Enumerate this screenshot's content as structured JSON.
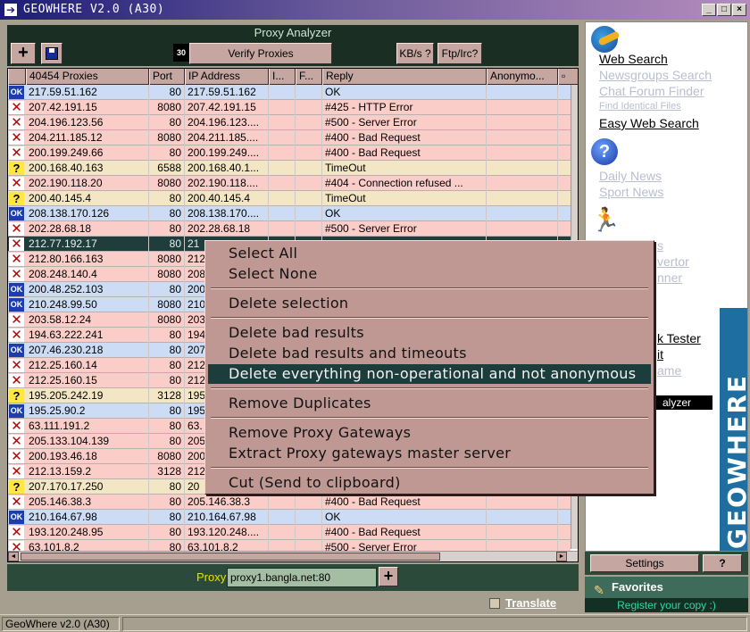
{
  "window": {
    "title": "GEOWHERE V2.0 (A30)",
    "buttons": {
      "minimize": "_",
      "maximize": "□",
      "close": "×"
    }
  },
  "analyzer": {
    "title": "Proxy Analyzer",
    "toolbar": {
      "add_label": "+",
      "save_icon": "floppy-disk-icon",
      "count": "30",
      "verify_label": "Verify Proxies",
      "kbs_label": "KB/s ?",
      "ftpirc_label": "Ftp/Irc?"
    },
    "columns": [
      "40454 Proxies",
      "Port",
      "IP Address",
      "I...",
      "F...",
      "Reply",
      "Anonymo..."
    ],
    "rows": [
      {
        "status": "ok",
        "icon": "OK",
        "proxy": "217.59.51.162",
        "port": "80",
        "ip": "217.59.51.162",
        "reply": "OK"
      },
      {
        "status": "bad",
        "icon": "✕",
        "proxy": "207.42.191.15",
        "port": "8080",
        "ip": "207.42.191.15",
        "reply": "#425 - HTTP Error"
      },
      {
        "status": "bad",
        "icon": "✕",
        "proxy": "204.196.123.56",
        "port": "80",
        "ip": "204.196.123....",
        "reply": "#500 - Server Error"
      },
      {
        "status": "bad",
        "icon": "✕",
        "proxy": "204.211.185.12",
        "port": "8080",
        "ip": "204.211.185....",
        "reply": "#400 - Bad Request"
      },
      {
        "status": "bad",
        "icon": "✕",
        "proxy": "200.199.249.66",
        "port": "80",
        "ip": "200.199.249....",
        "reply": "#400 - Bad Request"
      },
      {
        "status": "wait",
        "icon": "?",
        "proxy": "200.168.40.163",
        "port": "6588",
        "ip": "200.168.40.1...",
        "reply": "TimeOut"
      },
      {
        "status": "bad",
        "icon": "✕",
        "proxy": "202.190.118.20",
        "port": "8080",
        "ip": "202.190.118....",
        "reply": "#404 - Connection refused ..."
      },
      {
        "status": "wait",
        "icon": "?",
        "proxy": "200.40.145.4",
        "port": "80",
        "ip": "200.40.145.4",
        "reply": "TimeOut"
      },
      {
        "status": "ok",
        "icon": "OK",
        "proxy": "208.138.170.126",
        "port": "80",
        "ip": "208.138.170....",
        "reply": "OK"
      },
      {
        "status": "bad",
        "icon": "✕",
        "proxy": "202.28.68.18",
        "port": "80",
        "ip": "202.28.68.18",
        "reply": "#500 - Server Error"
      },
      {
        "status": "sel",
        "icon": "✕",
        "proxy": "212.77.192.17",
        "port": "80",
        "ip": "21",
        "reply": ""
      },
      {
        "status": "bad",
        "icon": "✕",
        "proxy": "212.80.166.163",
        "port": "8080",
        "ip": "212",
        "reply": ""
      },
      {
        "status": "bad",
        "icon": "✕",
        "proxy": "208.248.140.4",
        "port": "8080",
        "ip": "208",
        "reply": ""
      },
      {
        "status": "ok",
        "icon": "OK",
        "proxy": "200.48.252.103",
        "port": "80",
        "ip": "200",
        "reply": ""
      },
      {
        "status": "ok",
        "icon": "OK",
        "proxy": "210.248.99.50",
        "port": "8080",
        "ip": "210",
        "reply": ""
      },
      {
        "status": "bad",
        "icon": "✕",
        "proxy": "203.58.12.24",
        "port": "8080",
        "ip": "203",
        "reply": ""
      },
      {
        "status": "bad",
        "icon": "✕",
        "proxy": "194.63.222.241",
        "port": "80",
        "ip": "194",
        "reply": ""
      },
      {
        "status": "ok",
        "icon": "OK",
        "proxy": "207.46.230.218",
        "port": "80",
        "ip": "207",
        "reply": ""
      },
      {
        "status": "bad",
        "icon": "✕",
        "proxy": "212.25.160.14",
        "port": "80",
        "ip": "212",
        "reply": ""
      },
      {
        "status": "bad",
        "icon": "✕",
        "proxy": "212.25.160.15",
        "port": "80",
        "ip": "212",
        "reply": ""
      },
      {
        "status": "wait",
        "icon": "?",
        "proxy": "195.205.242.19",
        "port": "3128",
        "ip": "195",
        "reply": ""
      },
      {
        "status": "ok",
        "icon": "OK",
        "proxy": "195.25.90.2",
        "port": "80",
        "ip": "195",
        "reply": ""
      },
      {
        "status": "bad",
        "icon": "✕",
        "proxy": "63.111.191.2",
        "port": "80",
        "ip": "63.",
        "reply": ""
      },
      {
        "status": "bad",
        "icon": "✕",
        "proxy": "205.133.104.139",
        "port": "80",
        "ip": "205",
        "reply": ""
      },
      {
        "status": "bad",
        "icon": "✕",
        "proxy": "200.193.46.18",
        "port": "8080",
        "ip": "200",
        "reply": ""
      },
      {
        "status": "bad",
        "icon": "✕",
        "proxy": "212.13.159.2",
        "port": "3128",
        "ip": "212",
        "reply": ""
      },
      {
        "status": "wait",
        "icon": "?",
        "proxy": "207.170.17.250",
        "port": "80",
        "ip": "20",
        "reply": ""
      },
      {
        "status": "bad",
        "icon": "✕",
        "proxy": "205.146.38.3",
        "port": "80",
        "ip": "205.146.38.3",
        "reply": "#400 - Bad Request"
      },
      {
        "status": "ok",
        "icon": "OK",
        "proxy": "210.164.67.98",
        "port": "80",
        "ip": "210.164.67.98",
        "reply": "OK"
      },
      {
        "status": "bad",
        "icon": "✕",
        "proxy": "193.120.248.95",
        "port": "80",
        "ip": "193.120.248....",
        "reply": "#400 - Bad Request"
      },
      {
        "status": "bad",
        "icon": "✕",
        "proxy": "63.101.8.2",
        "port": "80",
        "ip": "63.101.8.2",
        "reply": "#500 - Server Error"
      }
    ],
    "proxy_label": "Proxy",
    "proxy_value": "proxy1.bangla.net:80",
    "proxy_add": "+"
  },
  "context_menu": {
    "items": [
      {
        "label": "Select All",
        "group": 0
      },
      {
        "label": "Select None",
        "group": 0
      },
      {
        "label": "Delete selection",
        "group": 1
      },
      {
        "label": "Delete bad results",
        "group": 2
      },
      {
        "label": "Delete bad results and timeouts",
        "group": 2
      },
      {
        "label": "Delete everything non-operational and not anonymous",
        "group": 2,
        "highlighted": true
      },
      {
        "label": "Remove Duplicates",
        "group": 3
      },
      {
        "label": "Remove Proxy Gateways",
        "group": 4
      },
      {
        "label": "Extract Proxy gateways master server",
        "group": 4
      },
      {
        "label": "Cut (Send to clipboard)",
        "group": 5
      }
    ]
  },
  "sidebar": {
    "search_links": [
      "Web Search",
      "Newsgroups Search",
      "Chat Forum Finder",
      "Find Identical Files",
      "Easy Web Search"
    ],
    "news_links": [
      "Daily News",
      "Sport News"
    ],
    "tools_partial": [
      "s",
      "vertor",
      "nner",
      "k Tester",
      "it",
      "ame",
      "alyzer"
    ],
    "brand": "GEOWHERE",
    "settings_label": "Settings",
    "help_label": "?",
    "favorites_label": "Favorites",
    "register_label": "Register your copy :)"
  },
  "footer": {
    "translate_label": "Translate",
    "status": "GeoWhere v2.0 (A30)"
  },
  "colors": {
    "bad_row": "#fbcdc8",
    "ok_row": "#cbdcf4",
    "timeout_row": "#f2e6c4",
    "selected_row": "#1f3d3a",
    "panel_dark": "#1b2e24",
    "brand_blue": "#1e6fa0"
  }
}
